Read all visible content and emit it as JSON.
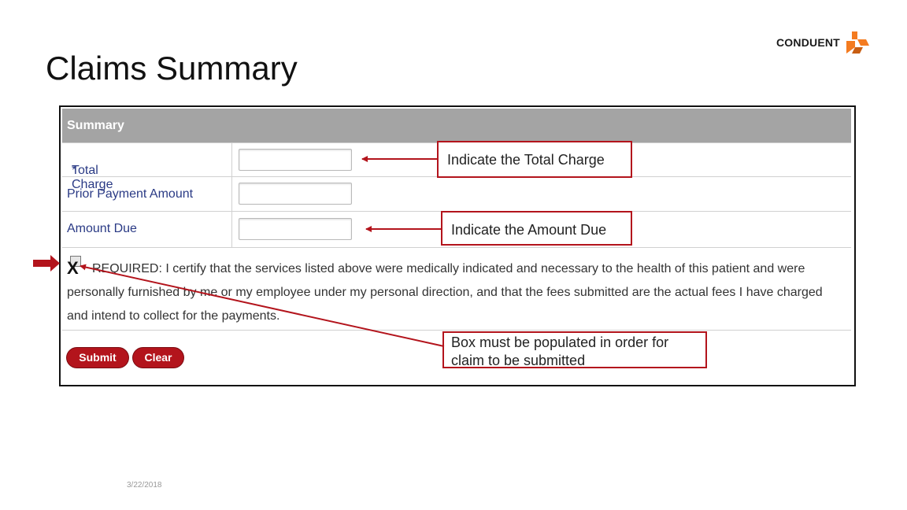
{
  "slide": {
    "title": "Claims Summary",
    "date": "3/22/2018",
    "logo_text": "CONDUENT",
    "accent_color": "#b3141c",
    "logo_orange": "#f47b20"
  },
  "form": {
    "header": "Summary",
    "rows": [
      {
        "required_mark": "*",
        "label": "Total Charge",
        "value": ""
      },
      {
        "label": "Prior Payment Amount",
        "value": ""
      },
      {
        "label": "Amount Due",
        "value": ""
      }
    ],
    "certification": {
      "checked": false,
      "text": "REQUIRED: I certify that the services listed above were medically indicated and necessary to the health of this patient and were personally furnished by me or my employee under my personal direction, and that the fees submitted are the actual fees I have charged and intend to collect for the payments."
    },
    "buttons": {
      "submit": "Submit",
      "clear": "Clear"
    }
  },
  "annotations": {
    "total_charge": "Indicate the Total Charge",
    "amount_due": "Indicate the Amount Due",
    "checkbox": "Box must be populated in order for claim to be submitted",
    "x_mark": "X"
  }
}
